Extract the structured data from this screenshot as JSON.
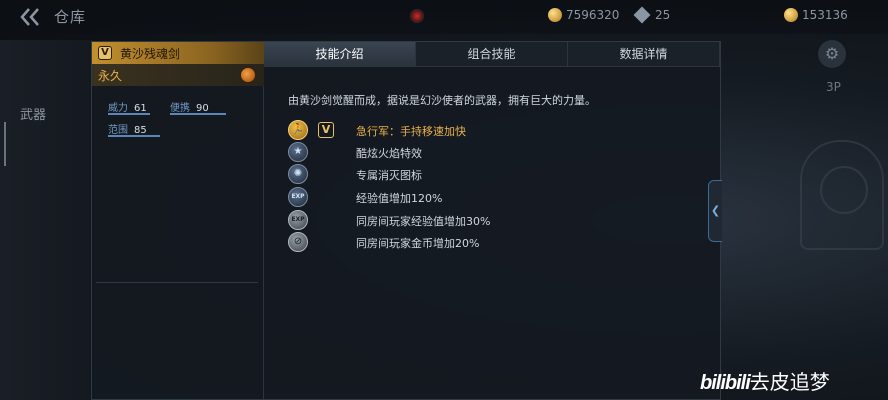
{
  "topbar": {
    "title": "仓库",
    "currencies": [
      "7596320",
      "25",
      "153136"
    ]
  },
  "left_nav": {
    "tab_label": "武器"
  },
  "right_hud": {
    "view_label": "3P"
  },
  "weapon": {
    "name": "黄沙残魂剑",
    "badge": "V",
    "duration": "永久",
    "stats": {
      "power_label": "威力",
      "power_value": "61",
      "carry_label": "便携",
      "carry_value": "90",
      "range_label": "范围",
      "range_value": "85"
    }
  },
  "tabs": [
    "技能介绍",
    "组合技能",
    "数据详情"
  ],
  "active_tab": 0,
  "description": "由黄沙剑觉醒而成，据说是幻沙使者的武器，拥有巨大的力量。",
  "skills": [
    {
      "label": "急行军：手持移速加快",
      "icon": "running-icon",
      "badge": "V",
      "highlight": true
    },
    {
      "label": "酷炫火焰特效",
      "icon": "star-icon"
    },
    {
      "label": "专属消灭图标",
      "icon": "eliminate-icon"
    },
    {
      "label": "经验值增加120%",
      "icon": "exp-icon"
    },
    {
      "label": "同房间玩家经验值增加30%",
      "icon": "exp-room-icon"
    },
    {
      "label": "同房间玩家金币增加20%",
      "icon": "coin-room-icon"
    }
  ],
  "watermark": {
    "logo": "bilibili",
    "text": "去皮追梦"
  },
  "colors": {
    "accent_gold": "#e8b24a",
    "header_gold": "#c28f2e",
    "stat_blue": "#6f9ac8"
  }
}
